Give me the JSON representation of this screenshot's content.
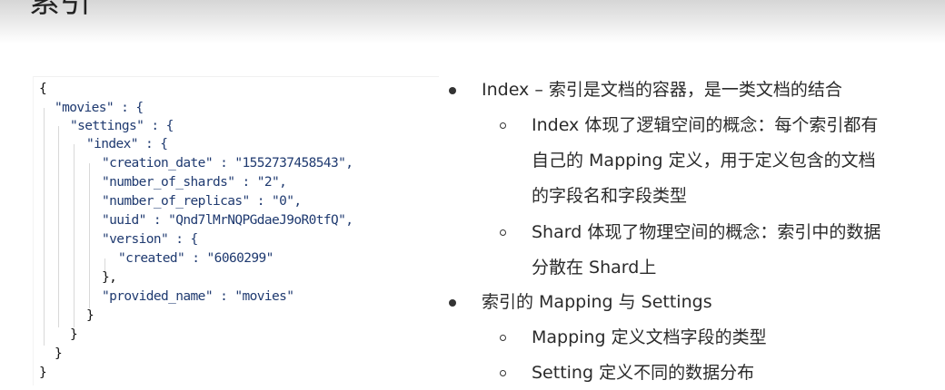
{
  "slide": {
    "title": "索引"
  },
  "code": {
    "lines": [
      "{",
      "\"movies\" : {",
      "\"settings\" : {",
      "\"index\" : {",
      "\"creation_date\" : \"1552737458543\",",
      "\"number_of_shards\" : \"2\",",
      "\"number_of_replicas\" : \"0\",",
      "\"uuid\" : \"Qnd7lMrNQPGdaeJ9oR0tfQ\",",
      "\"version\" : {",
      "\"created\" : \"6060299\"",
      "},",
      "\"provided_name\" : \"movies\"",
      "}",
      "}",
      "}",
      "}"
    ]
  },
  "notes": {
    "items": [
      {
        "level": 1,
        "text": "Index – 索引是文档的容器，是一类文档的结合"
      },
      {
        "level": 2,
        "text": "Index 体现了逻辑空间的概念：每个索引都有"
      },
      {
        "level": 2,
        "text": "自己的 Mapping 定义，用于定义包含的文档",
        "continuation": true
      },
      {
        "level": 2,
        "text": "的字段名和字段类型",
        "continuation": true
      },
      {
        "level": 2,
        "text": "Shard 体现了物理空间的概念：索引中的数据"
      },
      {
        "level": 2,
        "text": "分散在 Shard上",
        "continuation": true
      },
      {
        "level": 1,
        "text": "索引的 Mapping 与 Settings"
      },
      {
        "level": 2,
        "text": "Mapping 定义文档字段的类型"
      },
      {
        "level": 2,
        "text": "Setting 定义不同的数据分布"
      }
    ]
  }
}
